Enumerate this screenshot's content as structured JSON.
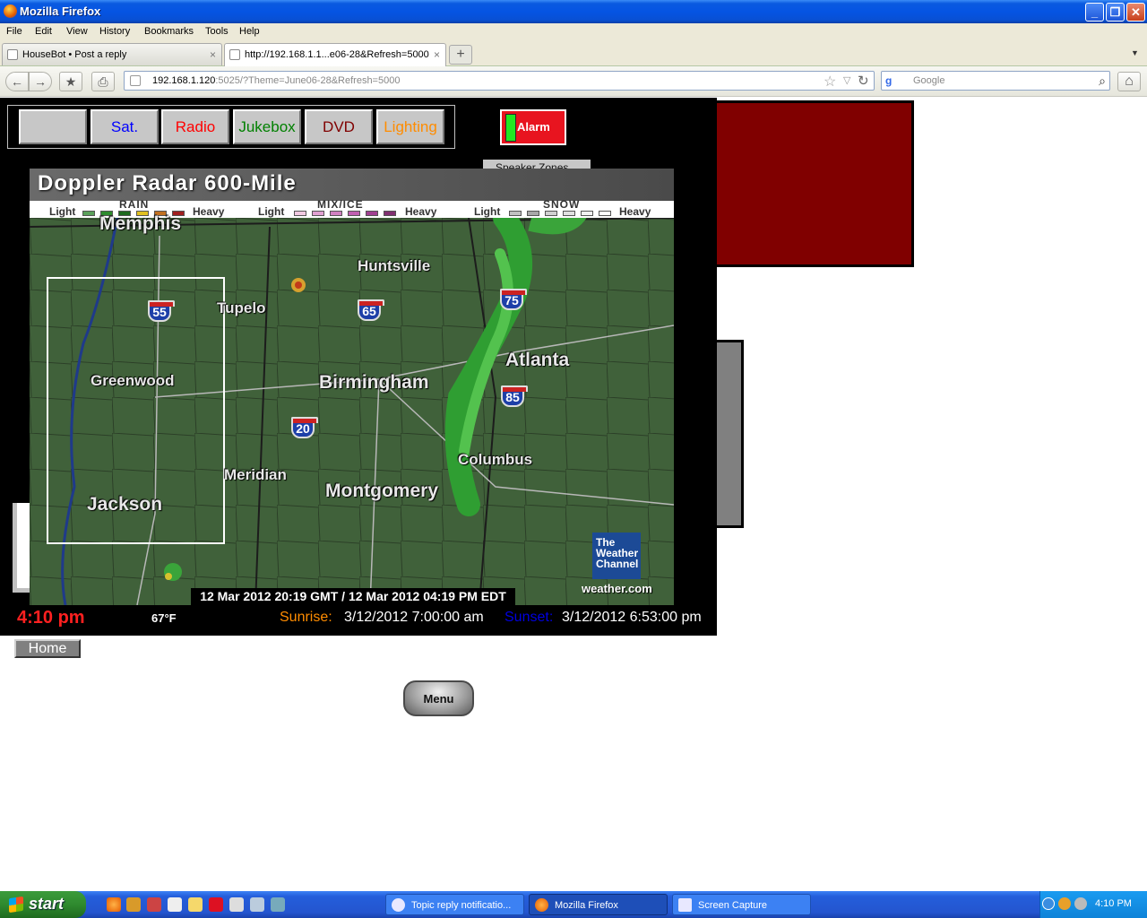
{
  "window": {
    "title": "Mozilla Firefox",
    "minimize": "_",
    "restore": "❐",
    "close": "✕"
  },
  "menu": [
    "File",
    "Edit",
    "View",
    "History",
    "Bookmarks",
    "Tools",
    "Help"
  ],
  "tabs": [
    {
      "label": "HouseBot • Post a reply",
      "close": "×"
    },
    {
      "label": "http://192.168.1.1...e06-28&Refresh=5000",
      "close": "×"
    }
  ],
  "newtab": "+",
  "tablist": "▼",
  "nav": {
    "back": "←",
    "forward": "→",
    "bookmark": "★",
    "print": "⎙",
    "url_host": "192.168.1.120",
    "url_rest": ":5025/?Theme=June06-28&Refresh=5000",
    "star": "☆",
    "drop": "▽",
    "reload": "↻",
    "search_engine": "g",
    "search_placeholder": "Google",
    "search_icon": "⌕",
    "home": "⌂"
  },
  "page": {
    "buttons": [
      {
        "label": "",
        "color": "#000000"
      },
      {
        "label": "Sat.",
        "color": "#0000ff"
      },
      {
        "label": "Radio",
        "color": "#ff0000"
      },
      {
        "label": "Jukebox",
        "color": "#008000"
      },
      {
        "label": "DVD",
        "color": "#800000"
      },
      {
        "label": "Lighting",
        "color": "#ff8c00"
      }
    ],
    "alarm": "Alarm",
    "speaker_zones": "Speaker Zones",
    "radar": {
      "title": "Doppler Radar 600-Mile",
      "legend": {
        "rain": "RAIN",
        "mix": "MIX/ICE",
        "snow": "SNOW",
        "light": "Light",
        "heavy": "Heavy",
        "rain_colors": [
          "#5aa05a",
          "#2e8b2e",
          "#1e6a1e",
          "#e0c020",
          "#c07020",
          "#a02020"
        ],
        "mix_colors": [
          "#f0c8e0",
          "#e0a0d0",
          "#d080c0",
          "#c060b0",
          "#a04090",
          "#803070"
        ],
        "snow_colors": [
          "#c0c0c0",
          "#a8a8a8",
          "#d0d0d0",
          "#e0e0e0",
          "#f0f0f0",
          "#ffffff"
        ]
      },
      "cities": [
        "Memphis",
        "Huntsville",
        "Tupelo",
        "Atlanta",
        "Greenwood",
        "Birmingham",
        "Meridian",
        "Columbus",
        "Montgomery",
        "Jackson"
      ],
      "shields": [
        "55",
        "65",
        "75",
        "85",
        "20"
      ],
      "brand": [
        "The",
        "Weather",
        "Channel"
      ],
      "brand_url": "weather.com",
      "timestamp": "12 Mar 2012 20:19 GMT / 12 Mar 2012 04:19 PM EDT"
    },
    "time": "4:10 pm",
    "temp": "67°F",
    "sunrise_label": "Sunrise:",
    "sunrise_value": "3/12/2012 7:00:00 am",
    "sunset_label": "Sunset:",
    "sunset_value": "3/12/2012 6:53:00 pm",
    "home": "Home",
    "menu_button": "Menu"
  },
  "taskbar": {
    "start": "start",
    "quick_launch": [
      "firefox-icon",
      "winamp-icon",
      "tool-icon",
      "media-icon",
      "chat-icon",
      "qt-icon",
      "network-icon",
      "globe-icon",
      "ie-icon"
    ],
    "tasks": [
      {
        "label": "Topic reply notificatio...",
        "active": false
      },
      {
        "label": "Mozilla Firefox",
        "active": true
      },
      {
        "label": "Screen Capture",
        "active": false
      }
    ],
    "clock": "4:10 PM"
  }
}
